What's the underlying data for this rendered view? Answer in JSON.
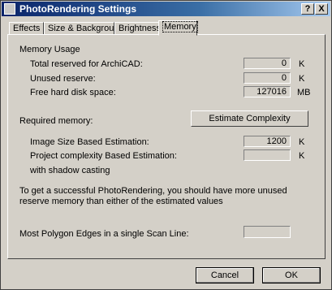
{
  "window": {
    "title": "PhotoRendering Settings",
    "help_button": "?",
    "close_button": "X"
  },
  "tabs": [
    {
      "label": "Effects"
    },
    {
      "label": "Size & Background"
    },
    {
      "label": "Brightness"
    },
    {
      "label": "Memory"
    }
  ],
  "memory": {
    "section_title": "Memory Usage",
    "rows": [
      {
        "label": "Total reserved for ArchiCAD:",
        "value": "0",
        "unit": "K"
      },
      {
        "label": "Unused reserve:",
        "value": "0",
        "unit": "K"
      },
      {
        "label": "Free hard disk space:",
        "value": "127016",
        "unit": "MB"
      }
    ],
    "required_label": "Required memory:",
    "estimate_button": "Estimate Complexity",
    "estimates": [
      {
        "label": "Image Size Based Estimation:",
        "value": "1200",
        "unit": "K"
      },
      {
        "label": "Project complexity Based Estimation:",
        "value": "",
        "unit": "K"
      }
    ],
    "shadow_note": "with shadow casting",
    "info_text": "To get a successful PhotoRendering, you should have more unused reserve memory than either of the estimated values",
    "edges_label": "Most Polygon Edges in a single Scan Line:",
    "edges_value": ""
  },
  "footer": {
    "cancel": "Cancel",
    "ok": "OK"
  }
}
